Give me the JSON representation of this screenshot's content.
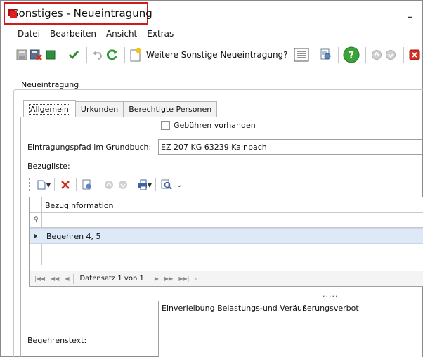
{
  "window": {
    "title": "Sonstiges - Neueintragung",
    "minimize_glyph": "_"
  },
  "menu": [
    "Datei",
    "Bearbeiten",
    "Ansicht",
    "Extras"
  ],
  "toolbar": {
    "new_entry_label": "Weitere Sonstige Neueintragung?",
    "icons": [
      "save-icon",
      "delete-save-icon",
      "green-square-icon",
      "checkmark-icon",
      "undo-icon",
      "refresh-icon",
      "new-document-icon",
      "list-view-icon",
      "preview-icon",
      "help-icon",
      "move-up-icon",
      "move-down-icon",
      "close-icon"
    ],
    "colors": {
      "check": "#2e8b2e",
      "help": "#3aa33a",
      "close": "#d22b1f"
    }
  },
  "group": {
    "title": "Neueintragung"
  },
  "tabs": [
    {
      "label": "Allgemein",
      "active": true
    },
    {
      "label": "Urkunden",
      "active": false
    },
    {
      "label": "Berechtigte Personen",
      "active": false
    }
  ],
  "form": {
    "fees_label": "Gebühren vorhanden",
    "fees_checked": false,
    "path_label": "Eintragungspfad im Grundbuch:",
    "path_value": "EZ 207 KG 63239 Kainbach",
    "reference_label": "Bezugliste:",
    "request_text_label": "Begehrenstext:",
    "request_text_value": "Einverleibung Belastungs-und Veräußerungsverbot"
  },
  "grid": {
    "column": "Bezuginformation",
    "rows": [
      "Begehren 4, 5"
    ],
    "navigator_text": "Datensatz 1 von 1",
    "selected_row_color": "#dde9f6"
  },
  "splitter_glyph": "....."
}
